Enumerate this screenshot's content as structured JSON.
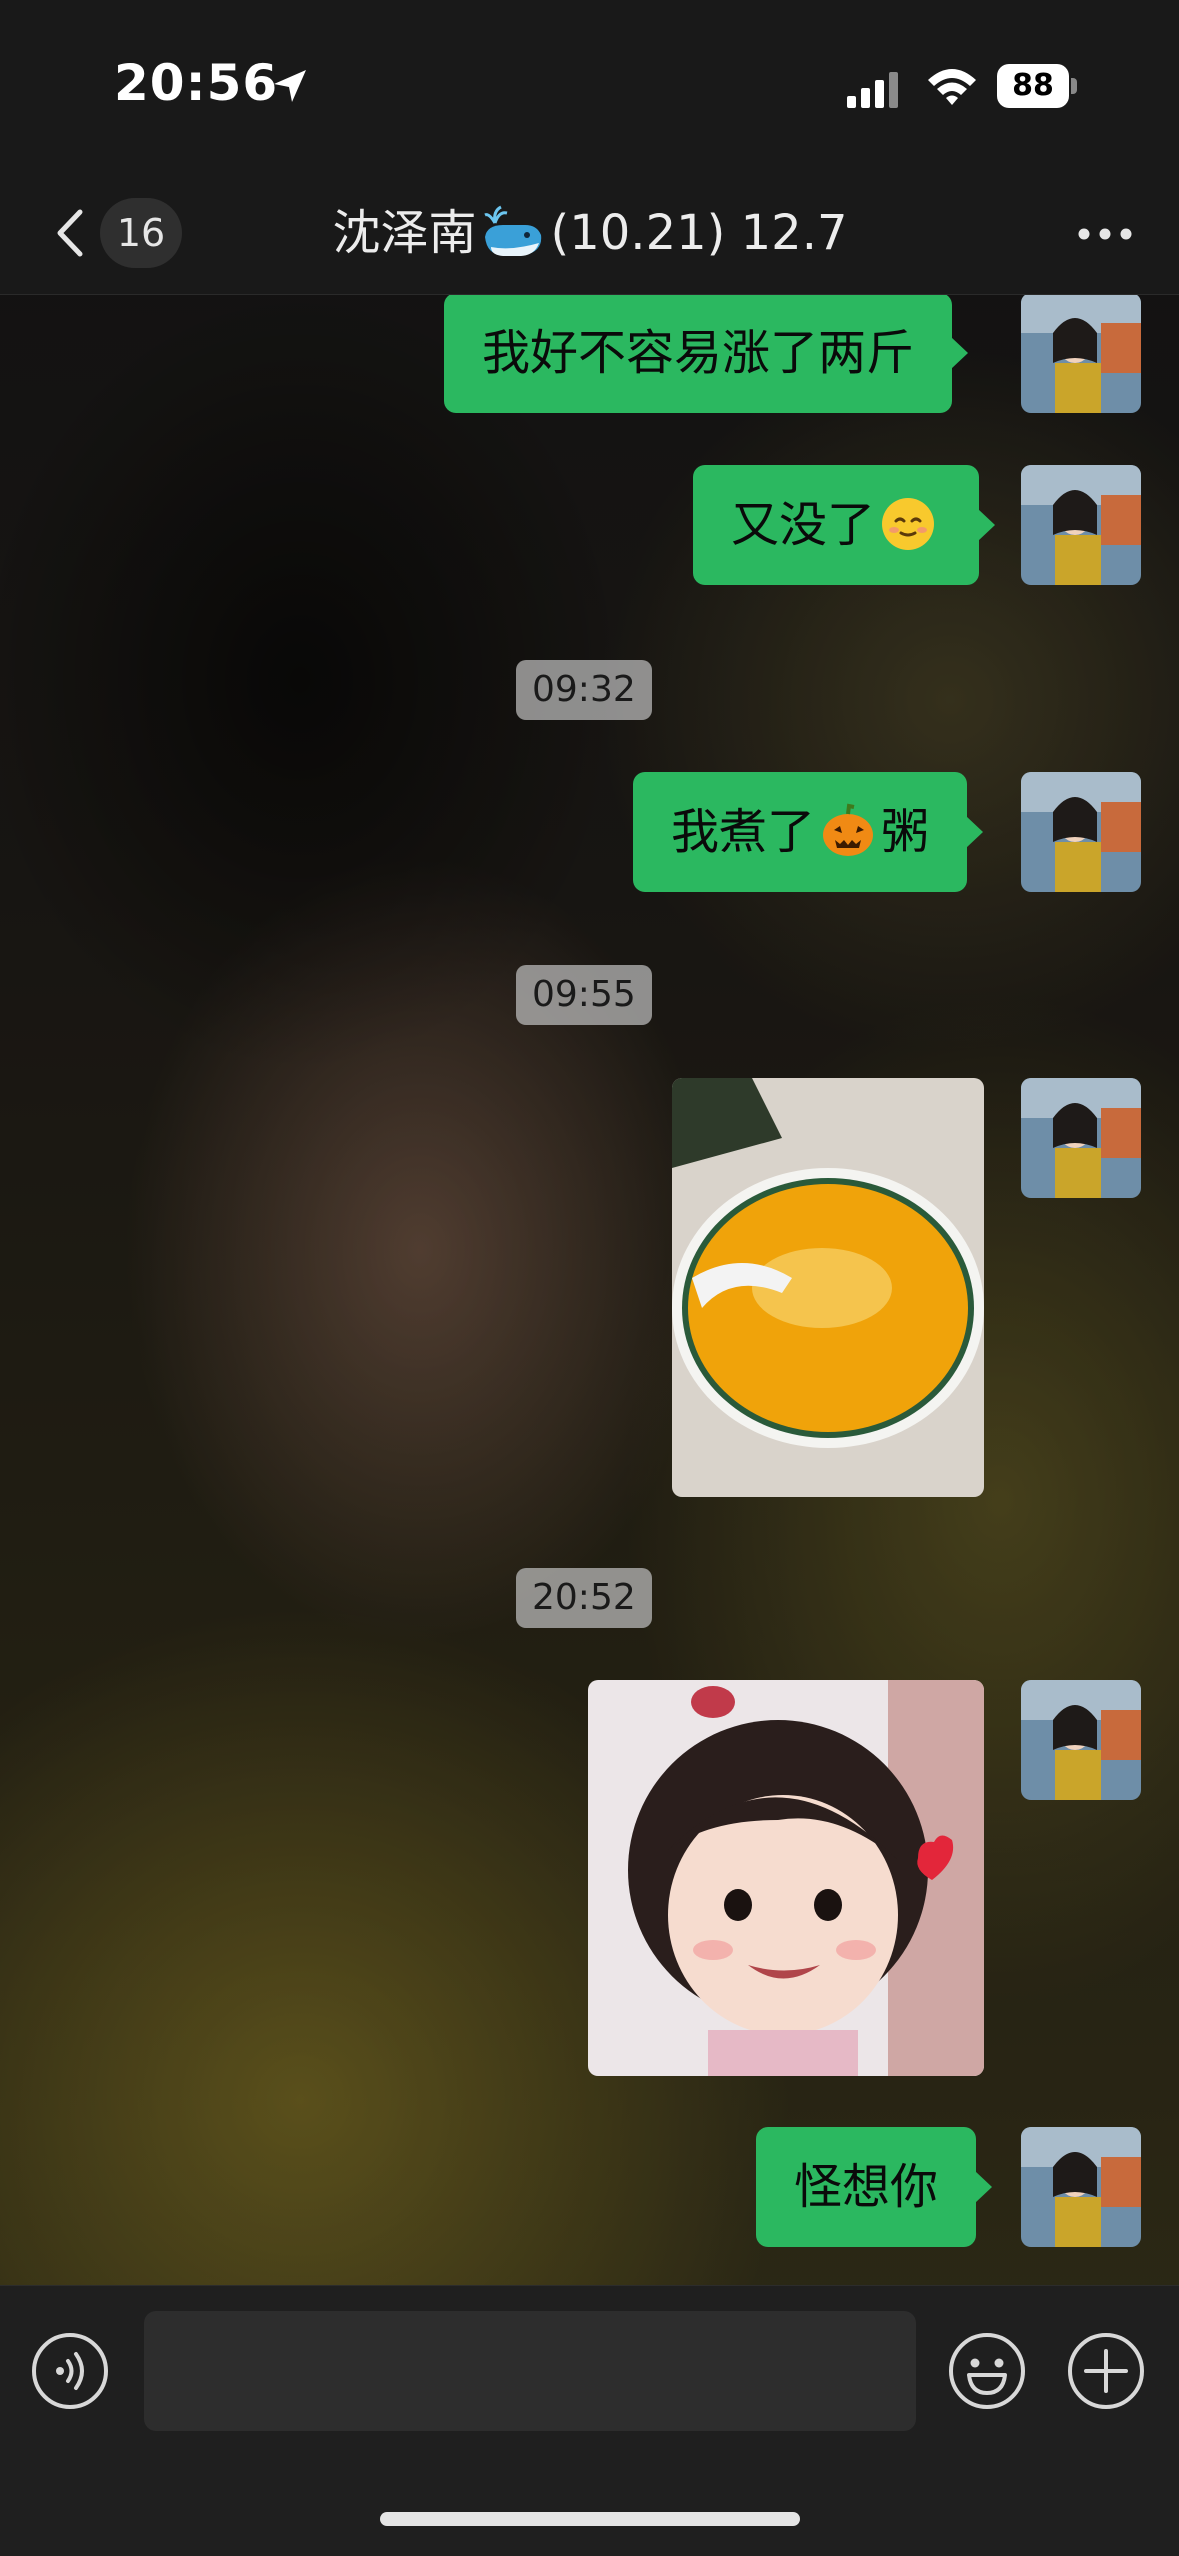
{
  "status_bar": {
    "time": "20:56",
    "battery_level": "88",
    "icons": [
      "location-arrow-icon",
      "signal-icon",
      "wifi-icon",
      "battery-icon"
    ]
  },
  "nav": {
    "unread_count": "16",
    "title_name": "沈泽南",
    "title_suffix": "(10.21) 12.7",
    "icons": [
      "back-chevron-icon",
      "whale-emoji-icon",
      "more-icon"
    ]
  },
  "messages": [
    {
      "type": "text",
      "from": "me",
      "text": "我好不容易涨了两斤"
    },
    {
      "type": "text",
      "from": "me",
      "text": "又没了",
      "emoji": "smiling-face-emoji"
    },
    {
      "type": "time",
      "text": "09:32"
    },
    {
      "type": "text",
      "from": "me",
      "text_before": "我煮了",
      "emoji": "pumpkin-emoji",
      "text_after": "粥"
    },
    {
      "type": "time",
      "text": "09:55"
    },
    {
      "type": "image",
      "from": "me",
      "subject": "pumpkin-porridge-photo"
    },
    {
      "type": "time",
      "text": "20:52"
    },
    {
      "type": "image",
      "from": "me",
      "subject": "baby-heart-sticker"
    },
    {
      "type": "text",
      "from": "me",
      "text": "怪想你"
    }
  ],
  "input_bar": {
    "placeholder": "",
    "icons": [
      "voice-icon",
      "emoji-face-icon",
      "plus-icon"
    ]
  },
  "colors": {
    "bubble_green": "#2bb860",
    "bar_background": "#191919",
    "time_pill": "#bebebe"
  }
}
